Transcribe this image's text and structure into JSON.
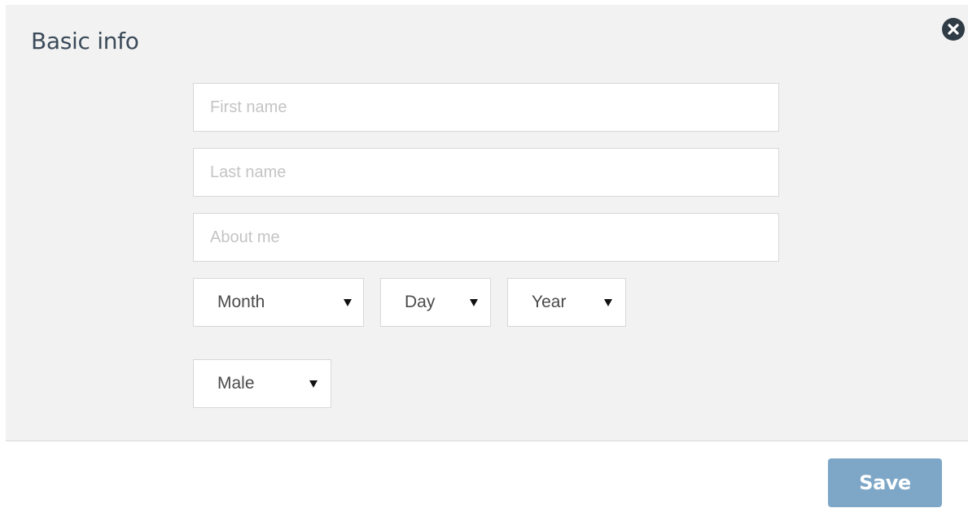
{
  "dialog": {
    "title": "Basic info",
    "close_icon": "close-circle-icon"
  },
  "form": {
    "first_name": {
      "placeholder": "First name",
      "value": ""
    },
    "last_name": {
      "placeholder": "Last name",
      "value": ""
    },
    "about_me": {
      "placeholder": "About me",
      "value": ""
    },
    "birth_month": {
      "selected": "Month",
      "icon": "dropdown-arrow-icon"
    },
    "birth_day": {
      "selected": "Day",
      "icon": "dropdown-arrow-icon"
    },
    "birth_year": {
      "selected": "Year",
      "icon": "dropdown-arrow-icon"
    },
    "gender": {
      "selected": "Male",
      "icon": "dropdown-arrow-icon"
    }
  },
  "footer": {
    "save_label": "Save"
  },
  "colors": {
    "body_background": "#f2f2f2",
    "title": "#3b4a59",
    "save_button": "#7ea7c7",
    "close_button": "#2f3b45"
  }
}
